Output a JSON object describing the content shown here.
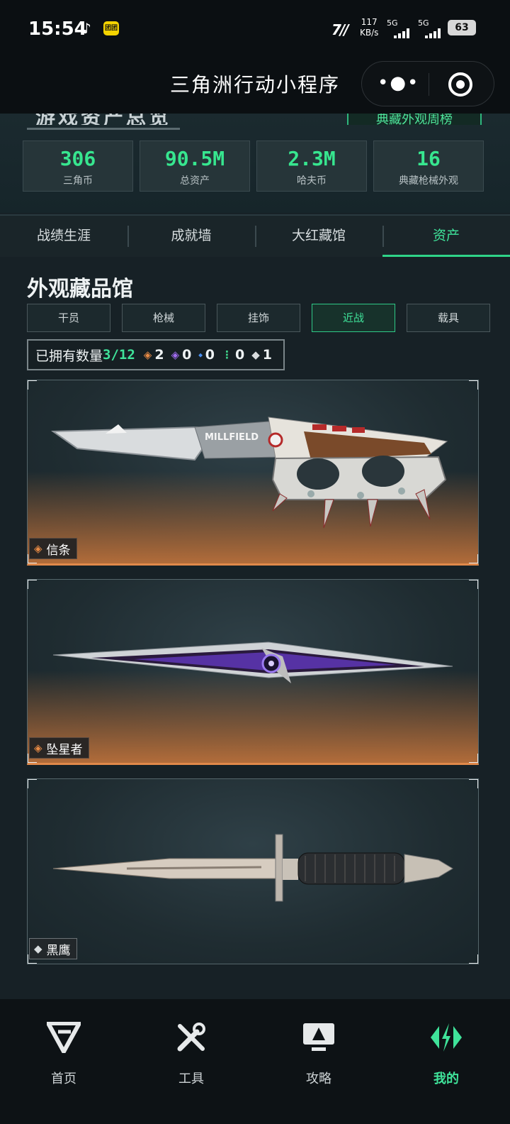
{
  "status_bar": {
    "time": "15:54",
    "app_badge": "团团",
    "net_speed_value": "117",
    "net_speed_unit": "KB/s",
    "sim1": "5G",
    "sim2": "5G",
    "battery": "63"
  },
  "header": {
    "title": "三角洲行动小程序",
    "more_icon": "more-dots-icon",
    "close_icon": "target-close-icon"
  },
  "summary": {
    "cut_title": "游戏资产总览",
    "rank_button": "典藏外观周榜",
    "stats": [
      {
        "value": "306",
        "label": "三角币"
      },
      {
        "value": "90.5M",
        "label": "总资产"
      },
      {
        "value": "2.3M",
        "label": "哈夫币"
      },
      {
        "value": "16",
        "label": "典藏枪械外观"
      }
    ]
  },
  "tabs": [
    "战绩生涯",
    "成就墙",
    "大红藏馆",
    "资产"
  ],
  "active_tab": "资产",
  "section_title": "外观藏品馆",
  "filters": [
    "干员",
    "枪械",
    "挂饰",
    "近战",
    "载具"
  ],
  "active_filter": "近战",
  "owned": {
    "label": "已拥有数量",
    "count": "3/12",
    "rarities": [
      {
        "icon": "orange-diamond-icon",
        "color": "#e88a45",
        "count": "2"
      },
      {
        "icon": "purple-diamond-icon",
        "color": "#a06cf0",
        "count": "0"
      },
      {
        "icon": "blue-diamond-icon",
        "color": "#4a8ff0",
        "count": "0"
      },
      {
        "icon": "green-diamond-icon",
        "color": "#3fd38a",
        "count": "0"
      },
      {
        "icon": "white-diamond-icon",
        "color": "#d8dcde",
        "count": "1"
      }
    ]
  },
  "items": [
    {
      "name": "信条",
      "rarity_color": "#e88a45",
      "engraving": "MILLFIELD"
    },
    {
      "name": "坠星者",
      "rarity_color": "#e88a45"
    },
    {
      "name": "黑鹰",
      "rarity_color": "#d8dcde"
    }
  ],
  "bottom_nav": [
    {
      "label": "首页",
      "icon": "delta-logo-icon"
    },
    {
      "label": "工具",
      "icon": "tools-icon"
    },
    {
      "label": "攻略",
      "icon": "monitor-guide-icon"
    },
    {
      "label": "我的",
      "icon": "profile-brand-icon"
    }
  ],
  "active_nav": "我的",
  "colors": {
    "accent": "#3fe39a",
    "orange": "#e88a45"
  }
}
